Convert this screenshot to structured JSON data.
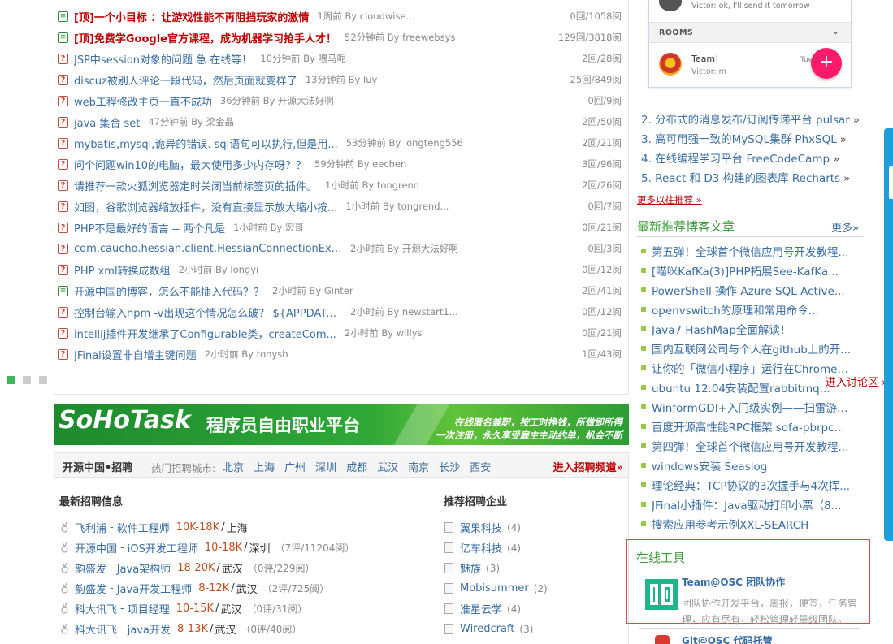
{
  "forum": {
    "topics": [
      {
        "icon": "doc-icon",
        "title": "[顶]一个小目标 ：让游戏性能不再阻挡玩家的激情",
        "top": true,
        "meta": "1周前 By cloudwise...",
        "stats": "0回/1058阅"
      },
      {
        "icon": "doc-icon",
        "title": "[顶]免费学Google官方课程，成为机器学习抢手人才！",
        "top": true,
        "meta": "52分钟前 By freewebsys",
        "stats": "129回/3818阅"
      },
      {
        "icon": "question-icon",
        "title": "JSP中session对象的问题 急 在线等！",
        "top": false,
        "meta": "10分钟前 By 喂马呢",
        "stats": "2回/28阅"
      },
      {
        "icon": "question-icon",
        "title": "discuz被别人评论一段代码，然后页面就变样了",
        "top": false,
        "meta": "13分钟前 By luv",
        "stats": "25回/849阅"
      },
      {
        "icon": "question-icon",
        "title": "web工程修改主页一直不成功",
        "top": false,
        "meta": "36分钟前 By 开源大法好啊",
        "stats": "0回/9阅"
      },
      {
        "icon": "question-icon",
        "title": "java 集合 set",
        "top": false,
        "meta": "47分钟前 By 梁金晶",
        "stats": "2回/50阅"
      },
      {
        "icon": "question-icon",
        "title": "mybatis,mysql,诡异的错误. sql语句可以执行,但是用...",
        "top": false,
        "meta": "53分钟前 By longteng556",
        "stats": "2回/21阅"
      },
      {
        "icon": "question-icon",
        "title": "问个问题win10的电脑，最大使用多少内存呀？？",
        "top": false,
        "meta": "59分钟前 By eechen",
        "stats": "3回/96阅"
      },
      {
        "icon": "question-icon",
        "title": "请推荐一款火狐浏览器定时关闭当前标签页的插件。",
        "top": false,
        "meta": "1小时前 By tongrend",
        "stats": "2回/26阅"
      },
      {
        "icon": "question-icon",
        "title": "如图，谷歌浏览器缩放插件，没有直接显示放大缩小按...",
        "top": false,
        "meta": "1小时前 By tongrend...",
        "stats": "0回/7阅"
      },
      {
        "icon": "question-icon",
        "title": "PHP不是最好的语言 -- 两个凡是",
        "top": false,
        "meta": "1小时前 By 宏哥",
        "stats": "0回/21阅"
      },
      {
        "icon": "question-icon",
        "title": "com.caucho.hessian.client.HessianConnectionExce...",
        "top": false,
        "meta": "2小时前 By 开源大法好啊",
        "stats": "0回/3阅"
      },
      {
        "icon": "question-icon",
        "title": "PHP xml转换成数组",
        "top": false,
        "meta": "2小时前 By longyi",
        "stats": "0回/12阅"
      },
      {
        "icon": "doc-icon",
        "title": "开源中国的博客，怎么不能插入代码？？",
        "top": false,
        "meta": "2小时前 By Ginter",
        "stats": "2回/41阅"
      },
      {
        "icon": "question-icon",
        "title": "控制台输入npm -v出现这个情况怎么破？ ${APPDATA...",
        "top": false,
        "meta": "2小时前 By newstart1...",
        "stats": "0回/12阅"
      },
      {
        "icon": "question-icon",
        "title": "intellij插件开发继承了Configurable类，createCom...",
        "top": false,
        "meta": "2小时前 By willys",
        "stats": "0回/21阅"
      },
      {
        "icon": "question-icon",
        "title": "JFinal设置非自增主键问题",
        "top": false,
        "meta": "2小时前 By tonysb",
        "stats": "1回/43阅"
      }
    ],
    "enter_link": "进入讨论区 »"
  },
  "banner": {
    "logo": "SoHoTask",
    "subtitle": "程序员自由职业平台",
    "line1": "在线匿名兼职，按工时挣钱，所做即所得",
    "line2": "一次注册，永久享受雇主主动约单，机会不断"
  },
  "jobs": {
    "title": "开源中国•招聘",
    "hot_label": "热门招聘城市:",
    "cities": [
      "北京",
      "上海",
      "广州",
      "深圳",
      "成都",
      "武汉",
      "南京",
      "长沙",
      "西安"
    ],
    "enter_link": "进入招聘频道»",
    "latest_title": "最新招聘信息",
    "enterprise_title": "推荐招聘企业",
    "listings": [
      {
        "company": "飞利浦",
        "position": "软件工程师",
        "salary": "10K-18K",
        "city": "上海",
        "reviews": ""
      },
      {
        "company": "开源中国",
        "position": "iOS开发工程师",
        "salary": "10-18K",
        "city": "深圳",
        "reviews": "（7评/11204阅）"
      },
      {
        "company": "韵盛发",
        "position": "Java架构师",
        "salary": "18-20K",
        "city": "武汉",
        "reviews": "（0评/229阅）"
      },
      {
        "company": "韵盛发",
        "position": "Java开发工程师",
        "salary": "8-12K",
        "city": "武汉",
        "reviews": "（2评/725阅）"
      },
      {
        "company": "科大讯飞",
        "position": "项目经理",
        "salary": "10-15K",
        "city": "武汉",
        "reviews": "（0评/31阅）"
      },
      {
        "company": "科大讯飞",
        "position": "java开发",
        "salary": "8-13K",
        "city": "武汉",
        "reviews": "（0评/40阅）"
      }
    ],
    "enterprises": [
      {
        "name": "翼果科技",
        "count": "(4)"
      },
      {
        "name": "亿车科技",
        "count": "(4)"
      },
      {
        "name": "魅族",
        "count": "(3)"
      },
      {
        "name": "Mobisummer",
        "count": "(2)"
      },
      {
        "name": "准星云学",
        "count": "(4)"
      },
      {
        "name": "Wiredcraft",
        "count": "(3)"
      }
    ]
  },
  "chat": {
    "last_message": "Victor: ok, I'll send it tomorrow",
    "rooms_label": "ROOMS",
    "room_name": "Team!",
    "room_sub": "Victor: m",
    "room_time": "Tue",
    "fab_label": "+"
  },
  "projects": {
    "items": [
      {
        "label": "2. 分布式的消息发布/订阅传递平台 pulsar",
        "arrow": "»"
      },
      {
        "label": "3. 高可用强一致的MySQL集群 PhxSQL",
        "arrow": "»"
      },
      {
        "label": "4. 在线编程学习平台 FreeCodeCamp",
        "arrow": "»"
      },
      {
        "label": "5. React 和 D3 构建的图表库 Recharts",
        "arrow": "»"
      }
    ],
    "more_link": "更多以往推荐 »"
  },
  "blogs": {
    "title": "最新推荐博客文章",
    "more": "更多»",
    "items": [
      "第五弹！全球首个微信应用号开发教程...",
      "[喵咪KafKa(3)]PHP拓展See-KafKa...",
      "PowerShell 操作 Azure SQL Active...",
      "openvswitch的原理和常用命令...",
      "Java7 HashMap全面解读！",
      "国内互联网公司与个人在github上的开...",
      "让你的「微信小程序」运行在Chrome浏...",
      "ubuntu 12.04安装配置rabbitmq...",
      "WinformGDI+入门级实例——扫雷游戏...",
      "百度开源高性能RPC框架 sofa-pbrpc...",
      "第四弹！全球首个微信应用号开发教程...",
      "windows安装 Seaslog",
      "理论经典：TCP协议的3次握手与4次挥...",
      "JFinal小插件：Java驱动打印小票（8...",
      "搜索应用参考示例XXL-SEARCH"
    ]
  },
  "tools": {
    "title": "在线工具",
    "team_name": "Team@OSC 团队协作",
    "team_desc": "团队协作开发平台，周报，便签，任务管理，应有尽有，轻松管理轻量级团队。",
    "git_name": "Git@OSC 代码托管"
  },
  "colors": {
    "accent_green": "#3a9d3a",
    "link_blue": "#3a6ea5",
    "top_red": "#c00000",
    "fab_pink": "#ff1a6c"
  }
}
